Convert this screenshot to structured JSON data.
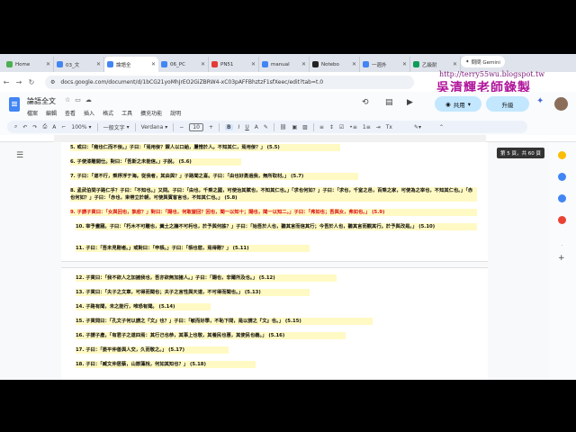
{
  "browser": {
    "tabs": [
      {
        "label": "Home",
        "color": "#4caf50"
      },
      {
        "label": "03_文",
        "color": "#4285f4"
      },
      {
        "label": "論語全",
        "color": "#4285f4",
        "active": true
      },
      {
        "label": "06_PC",
        "color": "#4285f4"
      },
      {
        "label": "PN51",
        "color": "#e53935"
      },
      {
        "label": "manual",
        "color": "#4285f4"
      },
      {
        "label": "Notebo",
        "color": "#222222"
      },
      {
        "label": "一週外",
        "color": "#4285f4"
      },
      {
        "label": "乙級耐",
        "color": "#0f9d58"
      }
    ],
    "new_tab": "+",
    "gemini_label": "問問 Gemini",
    "url": "docs.google.com/document/d/1bCG21yoMhJrEO2GiZBRW4-xC03pAFFBhztzF1sfXeec/edit?tab=t.0"
  },
  "overlay": {
    "blog_url": "http://terry55wu.blogspot.tw",
    "calligraphy": "吳清輝老師錄製"
  },
  "docs": {
    "title": "論語全文",
    "menu": [
      "檔案",
      "編輯",
      "查看",
      "插入",
      "格式",
      "工具",
      "擴充功能",
      "說明"
    ],
    "share_label": "共用",
    "upgrade_label": "升級",
    "toolbar": {
      "zoom": "100%",
      "style": "一般文字",
      "font": "Verdana",
      "font_size": "10"
    },
    "page_tooltip": "第 5 頁，共 60 頁"
  },
  "paragraphs": [
    {
      "text": "5.  或曰：「雍也仁而不佞。」子曰：「焉用佞？禦人以口給，屢憎於人。不知其仁，焉用佞？」 (5.5)",
      "red": false
    },
    {
      "text": "6.  子使漆雕開仕。對曰：「吾斯之未能信。」子說。 (5.6)",
      "red": false
    },
    {
      "text": "7.  子曰：「道不行，乘桴浮于海。從我者，其由與？」子路聞之喜。子曰：「由也好勇過我，無所取材。」 (5.7)",
      "red": false
    },
    {
      "text": "8.  孟武伯問子路仁乎？子曰：「不知也。」又問。子曰：「由也，千乘之國，可使治其賦也，不知其仁也。」「求也何如？」子曰：「求也，千室之邑，百乘之家，可使為之宰也，不知其仁也。」「赤也何如？」子曰：「赤也，束帶立於朝，可使與賓客言也，不知其仁也。」 (5.8)",
      "red": false
    },
    {
      "text": "9.  子謂子貢曰：「女與回也，孰愈？」對曰：「賜也，何敢望回？回也，聞一以知十；賜也，聞一以知二。」子曰：「弗如也；吾與女，弗如也。」 (5.9)",
      "red": true
    },
    {
      "text": "10.  宰予晝寢。子曰：「朽木不可雕也，糞土之牆不可杇也，於予與何誅？」子曰：「始吾於人也，聽其言而信其行；今吾於人也，聽其言而觀其行。於予與改是。」 (5.10)",
      "red": false
    },
    {
      "text": "11.  子曰：「吾未見剛者。」或對曰：「申棖。」子曰：「棖也慾，焉得剛？」 (5.11)",
      "red": false
    },
    {
      "text": "12.  子貢曰：「我不欲人之加諸我也，吾亦欲無加諸人。」子曰：「賜也，非爾所及也。」 (5.12)",
      "red": false
    },
    {
      "text": "13.  子貢曰：「夫子之文章，可得而聞也；夫子之言性與天道，不可得而聞也。」 (5.13)",
      "red": false
    },
    {
      "text": "14.  子路有聞，未之能行，唯恐有聞。 (5.14)",
      "red": false
    },
    {
      "text": "15.  子貢問曰：「孔文子何以謂之『文』也？」子曰：「敏而好學，不恥下問，是以謂之『文』也。」 (5.15)",
      "red": false
    },
    {
      "text": "16.  子謂子產，「有君子之道四焉：其行己也恭，其事上也敬，其養民也惠，其使民也義。」 (5.16)",
      "red": false
    },
    {
      "text": "17.  子曰：「晏平仲善與人交，久而敬之。」 (5.17)",
      "red": false
    },
    {
      "text": "18.  子曰：「臧文仲居蔡，山節藻梲，何如其知也？」 (5.18)",
      "red": false
    }
  ]
}
